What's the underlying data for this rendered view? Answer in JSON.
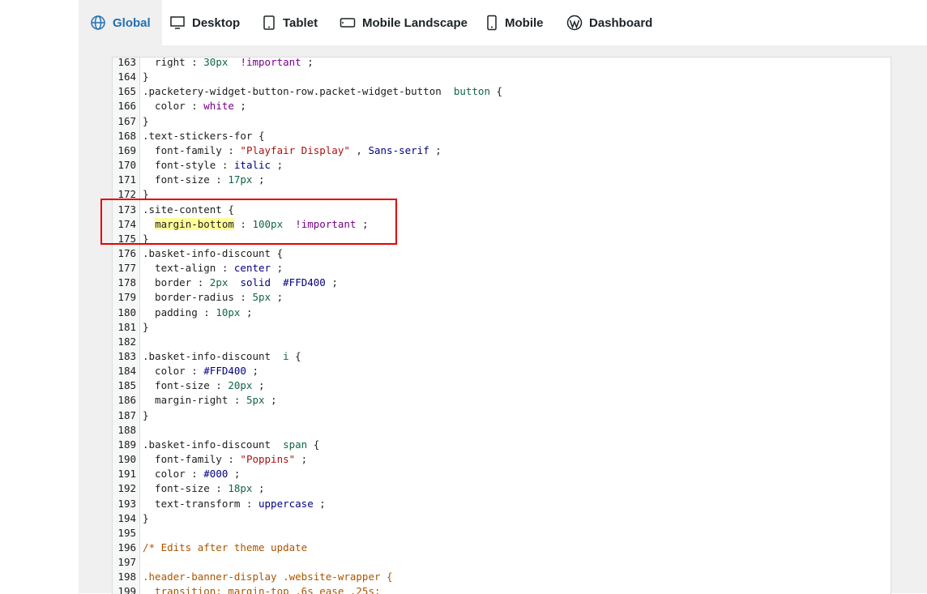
{
  "tabs": [
    {
      "label": "Global",
      "icon": "globe-icon",
      "active": true
    },
    {
      "label": "Desktop",
      "icon": "desktop-icon",
      "active": false
    },
    {
      "label": "Tablet",
      "icon": "tablet-icon",
      "active": false
    },
    {
      "label": "Mobile Landscape",
      "icon": "mobile-landscape-icon",
      "active": false
    },
    {
      "label": "Mobile",
      "icon": "mobile-icon",
      "active": false
    },
    {
      "label": "Dashboard",
      "icon": "wordpress-icon",
      "active": false
    }
  ],
  "colors": {
    "accent": "#2271b1",
    "highlight_box": "#e60000",
    "selection_highlight": "#ffff99"
  },
  "code_lines": [
    {
      "n": "163",
      "parts": [
        [
          "",
          "  right : "
        ],
        [
          "num",
          "30px"
        ],
        [
          "",
          "  "
        ],
        [
          "imp",
          "!important"
        ],
        [
          "",
          " ;"
        ]
      ]
    },
    {
      "n": "164",
      "parts": [
        [
          "",
          "}"
        ]
      ]
    },
    {
      "n": "165",
      "parts": [
        [
          "",
          ".packetery-widget-button-row.packet-widget-button  "
        ],
        [
          "num",
          "button"
        ],
        [
          "",
          " {"
        ]
      ]
    },
    {
      "n": "166",
      "parts": [
        [
          "",
          "  color : "
        ],
        [
          "imp",
          "white"
        ],
        [
          "",
          " ;"
        ]
      ]
    },
    {
      "n": "167",
      "parts": [
        [
          "",
          "}"
        ]
      ]
    },
    {
      "n": "168",
      "parts": [
        [
          "",
          ".text-stickers-for {"
        ]
      ]
    },
    {
      "n": "169",
      "parts": [
        [
          "",
          "  font-family : "
        ],
        [
          "str",
          "\"Playfair Display\""
        ],
        [
          "",
          " , "
        ],
        [
          "kw",
          "Sans-serif"
        ],
        [
          "",
          " ;"
        ]
      ]
    },
    {
      "n": "170",
      "parts": [
        [
          "",
          "  font-style : "
        ],
        [
          "kw",
          "italic"
        ],
        [
          "",
          " ;"
        ]
      ]
    },
    {
      "n": "171",
      "parts": [
        [
          "",
          "  font-size : "
        ],
        [
          "num",
          "17px"
        ],
        [
          "",
          " ;"
        ]
      ]
    },
    {
      "n": "172",
      "parts": [
        [
          "",
          "}"
        ]
      ]
    },
    {
      "n": "173",
      "parts": [
        [
          "",
          ".site-content {"
        ]
      ]
    },
    {
      "n": "174",
      "parts": [
        [
          "",
          "  "
        ],
        [
          "hl",
          "margin-bottom"
        ],
        [
          "",
          " : "
        ],
        [
          "num",
          "100px"
        ],
        [
          "",
          "  "
        ],
        [
          "imp",
          "!important"
        ],
        [
          "",
          " ;"
        ]
      ]
    },
    {
      "n": "175",
      "parts": [
        [
          "",
          "}"
        ]
      ]
    },
    {
      "n": "176",
      "parts": [
        [
          "",
          ".basket-info-discount {"
        ]
      ]
    },
    {
      "n": "177",
      "parts": [
        [
          "",
          "  text-align : "
        ],
        [
          "kw",
          "center"
        ],
        [
          "",
          " ;"
        ]
      ]
    },
    {
      "n": "178",
      "parts": [
        [
          "",
          "  border : "
        ],
        [
          "num",
          "2px"
        ],
        [
          "",
          "  "
        ],
        [
          "kw",
          "solid"
        ],
        [
          "",
          "  "
        ],
        [
          "kw",
          "#FFD400"
        ],
        [
          "",
          " ;"
        ]
      ]
    },
    {
      "n": "179",
      "parts": [
        [
          "",
          "  border-radius : "
        ],
        [
          "num",
          "5px"
        ],
        [
          "",
          " ;"
        ]
      ]
    },
    {
      "n": "180",
      "parts": [
        [
          "",
          "  padding : "
        ],
        [
          "num",
          "10px"
        ],
        [
          "",
          " ;"
        ]
      ]
    },
    {
      "n": "181",
      "parts": [
        [
          "",
          "}"
        ]
      ]
    },
    {
      "n": "182",
      "parts": [
        [
          "",
          ""
        ]
      ]
    },
    {
      "n": "183",
      "parts": [
        [
          "",
          ".basket-info-discount  "
        ],
        [
          "num",
          "i"
        ],
        [
          "",
          " {"
        ]
      ]
    },
    {
      "n": "184",
      "parts": [
        [
          "",
          "  color : "
        ],
        [
          "kw",
          "#FFD400"
        ],
        [
          "",
          " ;"
        ]
      ]
    },
    {
      "n": "185",
      "parts": [
        [
          "",
          "  font-size : "
        ],
        [
          "num",
          "20px"
        ],
        [
          "",
          " ;"
        ]
      ]
    },
    {
      "n": "186",
      "parts": [
        [
          "",
          "  margin-right : "
        ],
        [
          "num",
          "5px"
        ],
        [
          "",
          " ;"
        ]
      ]
    },
    {
      "n": "187",
      "parts": [
        [
          "",
          "}"
        ]
      ]
    },
    {
      "n": "188",
      "parts": [
        [
          "",
          ""
        ]
      ]
    },
    {
      "n": "189",
      "parts": [
        [
          "",
          ".basket-info-discount  "
        ],
        [
          "num",
          "span"
        ],
        [
          "",
          " {"
        ]
      ]
    },
    {
      "n": "190",
      "parts": [
        [
          "",
          "  font-family : "
        ],
        [
          "str",
          "\"Poppins\""
        ],
        [
          "",
          " ;"
        ]
      ]
    },
    {
      "n": "191",
      "parts": [
        [
          "",
          "  color : "
        ],
        [
          "kw",
          "#000"
        ],
        [
          "",
          " ;"
        ]
      ]
    },
    {
      "n": "192",
      "parts": [
        [
          "",
          "  font-size : "
        ],
        [
          "num",
          "18px"
        ],
        [
          "",
          " ;"
        ]
      ]
    },
    {
      "n": "193",
      "parts": [
        [
          "",
          "  text-transform : "
        ],
        [
          "kw",
          "uppercase"
        ],
        [
          "",
          " ;"
        ]
      ]
    },
    {
      "n": "194",
      "parts": [
        [
          "",
          "}"
        ]
      ]
    },
    {
      "n": "195",
      "parts": [
        [
          "",
          ""
        ]
      ]
    },
    {
      "n": "196",
      "parts": [
        [
          "cmt",
          "/* Edits after theme update"
        ]
      ]
    },
    {
      "n": "197",
      "parts": [
        [
          "",
          ""
        ]
      ]
    },
    {
      "n": "198",
      "parts": [
        [
          "cmt",
          ".header-banner-display .website-wrapper {"
        ]
      ]
    },
    {
      "n": "199",
      "parts": [
        [
          "cmt",
          "  transition: margin-top .6s ease .25s;"
        ]
      ]
    }
  ]
}
